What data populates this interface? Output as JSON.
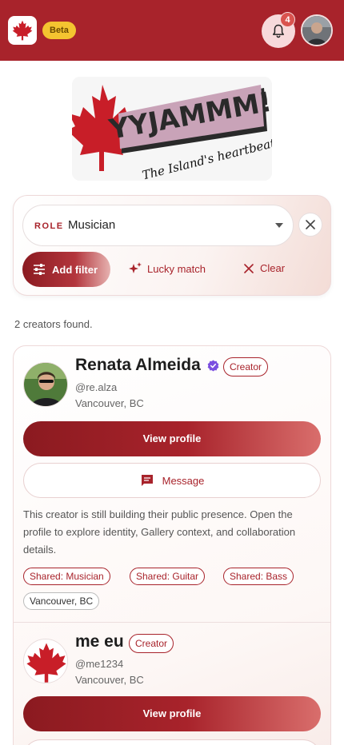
{
  "header": {
    "logo_icon": "maple-leaf-icon",
    "beta_label": "Beta",
    "notification_count": "4",
    "bell_icon": "bell-icon",
    "avatar": "user-avatar"
  },
  "hero": {
    "logo_text": "YYJAMMM!",
    "tagline": "The Island's heartbeat"
  },
  "filters": {
    "role_key": "ROLE",
    "role_value": "Musician",
    "add_filter_label": "Add filter",
    "lucky_label": "Lucky match",
    "clear_label": "Clear"
  },
  "results": {
    "count_text": "2 creators found."
  },
  "creators": [
    {
      "name": "Renata Almeida",
      "verified": true,
      "badge": "Creator",
      "handle": "@re.alza",
      "location": "Vancouver, BC",
      "view_label": "View profile",
      "message_label": "Message",
      "description": "This creator is still building their public presence. Open the profile to explore identity, Gallery context, and collaboration details.",
      "tags": [
        "Shared: Musician",
        "Shared: Guitar",
        "Shared: Bass"
      ],
      "location_tag": "Vancouver, BC"
    },
    {
      "name": "me eu",
      "verified": false,
      "badge": "Creator",
      "handle": "@me1234",
      "location": "Vancouver, BC",
      "view_label": "View profile"
    }
  ],
  "colors": {
    "brand_red": "#a8232b",
    "beta_yellow": "#f4c430",
    "verified_purple": "#7b4fe0"
  }
}
